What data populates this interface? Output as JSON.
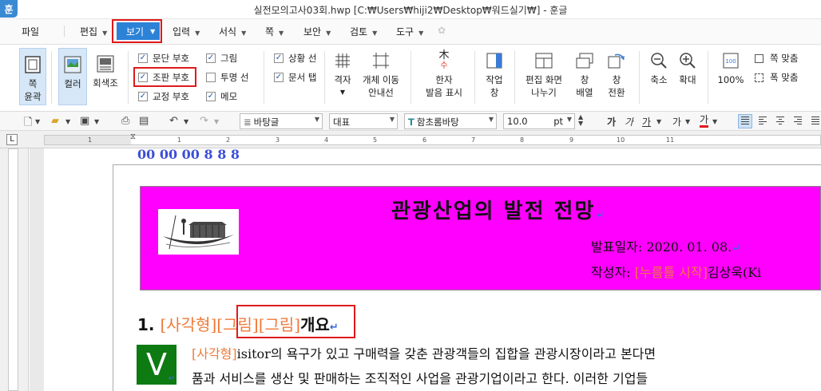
{
  "window": {
    "app_icon": "훈",
    "title": "실전모의고사03회.hwp [C:₩Users₩hiji2₩Desktop₩워드실기₩] - 훈글"
  },
  "menu": {
    "items": [
      "파일",
      "편집",
      "보기",
      "입력",
      "서식",
      "쪽",
      "보안",
      "검토",
      "도구"
    ],
    "active": "보기"
  },
  "ribbon": {
    "page_outline": "쪽\n윤곽",
    "color": "컬러",
    "grayscale": "회색조",
    "checks": [
      {
        "label": "문단 부호",
        "checked": true
      },
      {
        "label": "조판 부호",
        "checked": true
      },
      {
        "label": "교정 부호",
        "checked": true
      },
      {
        "label": "그림",
        "checked": true
      },
      {
        "label": "투명 선",
        "checked": false
      },
      {
        "label": "메모",
        "checked": true
      },
      {
        "label": "상황 선",
        "checked": true
      },
      {
        "label": "문서 탭",
        "checked": true
      }
    ],
    "grid": "격자",
    "object_move": "개체 이동\n안내선",
    "hanja": "한자\n발음 표시",
    "work_window": "작업\n창",
    "split_screen": "편집 화면\n나누기",
    "window_arrange": "창\n배열",
    "window_switch": "창\n전환",
    "zoom_out": "축소",
    "zoom_in": "확대",
    "zoom_100": "100%",
    "fit_width": "쪽 맞춤",
    "fit_page": "폭 맞춤"
  },
  "toolbar": {
    "style": "바탕글",
    "lang": "대표",
    "font": "함초롬바탕",
    "size": "10.0",
    "unit": "pt",
    "fmt_buttons": [
      "가",
      "가",
      "가",
      "가",
      "가"
    ]
  },
  "ruler": {
    "corner": "L",
    "numbers": [
      "1",
      "1",
      "2",
      "3",
      "4",
      "5",
      "6",
      "7",
      "8",
      "9",
      "10",
      "11"
    ]
  },
  "document": {
    "top_partial": "00 00 00 8 8 8",
    "title": "관광산업의 발전 전망",
    "date_label": "발표일자:",
    "date_value": "2020. 01. 08.",
    "author_label": "작성자:",
    "author_field": "[누름틀 시작]",
    "author_name": "김상욱(Ki",
    "heading_num": "1.",
    "heading_fields": "[사각형][그림][그림]",
    "heading_text": "개요",
    "dropcap": "V",
    "para1_field": "[사각형]",
    "para1_text": "isitor의 욕구가 있고 구매력을 갖춘 관광객들의 집합을 관광시장이라고 본다면",
    "para2_text": "품과 서비스를 생산 및 판매하는 조직적인 사업을 관광기업이라고 한다. 이러한 기업들"
  }
}
